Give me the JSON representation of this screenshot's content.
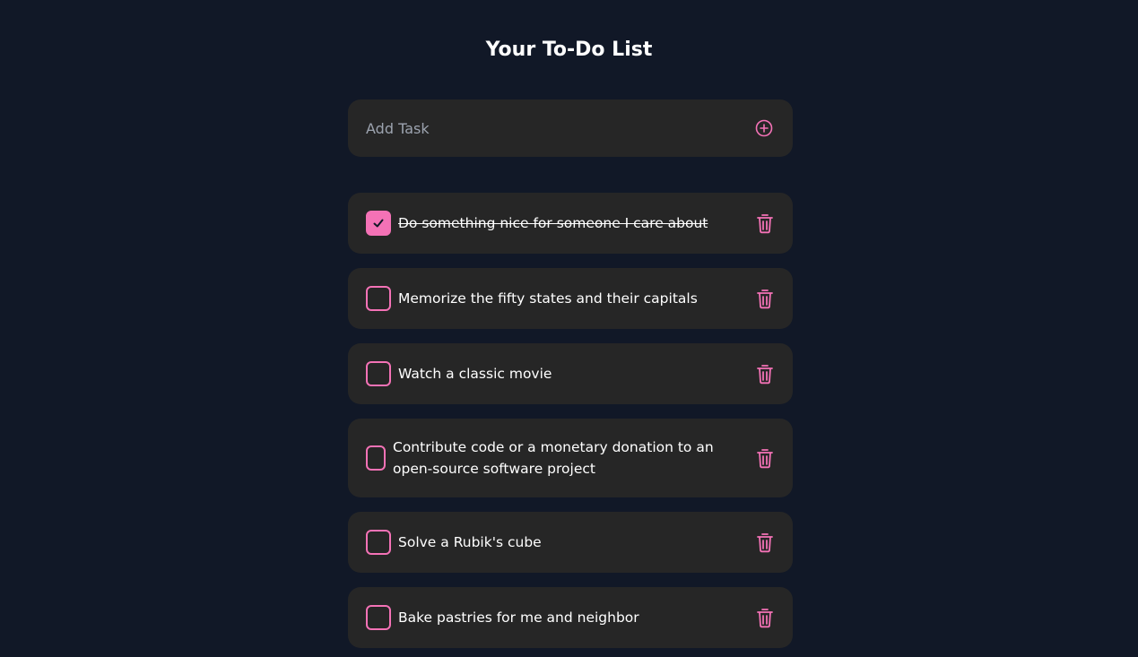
{
  "header": {
    "title": "Your To-Do List"
  },
  "add_task": {
    "placeholder": "Add Task",
    "button_icon": "plus-circle-icon"
  },
  "colors": {
    "background": "#111827",
    "card": "#262626",
    "accent": "#f472b6",
    "placeholder": "#9ca3af"
  },
  "tasks": [
    {
      "text": "Do something nice for someone I care about",
      "completed": true
    },
    {
      "text": "Memorize the fifty states and their capitals",
      "completed": false
    },
    {
      "text": "Watch a classic movie",
      "completed": false
    },
    {
      "text": "Contribute code or a monetary donation to an open-source software project",
      "completed": false
    },
    {
      "text": "Solve a Rubik's cube",
      "completed": false
    },
    {
      "text": "Bake pastries for me and neighbor",
      "completed": false
    }
  ],
  "icons": {
    "check": "check-icon",
    "delete": "trash-icon"
  }
}
